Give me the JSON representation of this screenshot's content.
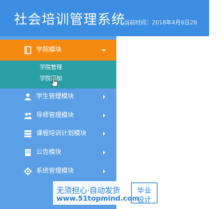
{
  "header": {
    "title": "社会培训管理系统",
    "current_time": "当前时间：2018年4月6日20"
  },
  "sidebar": {
    "items": [
      {
        "label": "学院模块",
        "icon": "book-icon",
        "active": true,
        "expanded": true
      },
      {
        "label": "学生管理模块",
        "icon": "user-icon"
      },
      {
        "label": "导师管理模块",
        "icon": "users-icon"
      },
      {
        "label": "课程培训计划模块",
        "icon": "stack-icon"
      },
      {
        "label": "公告模块",
        "icon": "document-icon"
      },
      {
        "label": "系统管理模块",
        "icon": "gear-icon"
      }
    ],
    "subitems": [
      {
        "label": "学院管理"
      },
      {
        "label": "学院添加"
      }
    ]
  },
  "watermark": {
    "line1": "无须担心·自动发货",
    "line2": "www.51topmind.com",
    "badge_line1": "毕业",
    "badge_line2": "设计"
  },
  "colors": {
    "header_bg": "#3c8ee2",
    "sidebar_bg": "#5b9fe6",
    "active_bg": "#f58a13",
    "submenu_bg": "#2b9fa6"
  }
}
